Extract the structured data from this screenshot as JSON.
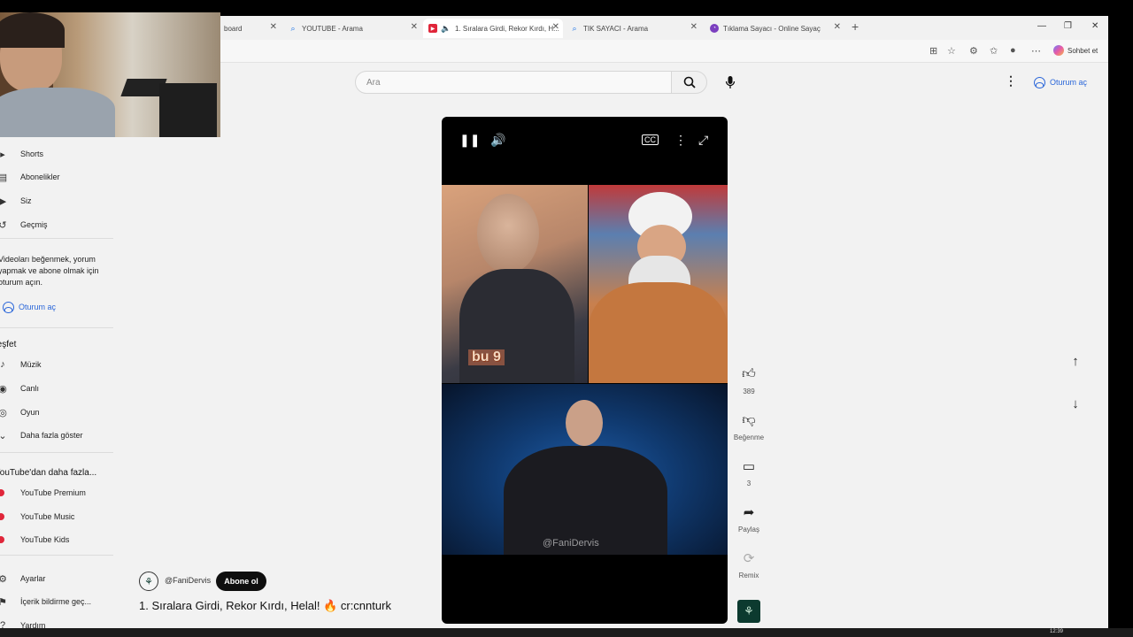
{
  "browser": {
    "tabs": [
      {
        "label": "board",
        "icon": "dashboard-icon",
        "active": false
      },
      {
        "label": "YOUTUBE - Arama",
        "icon": "search-icon",
        "active": false
      },
      {
        "label": "1. Sıralara Girdi, Rekor Kırdı, H...",
        "icon": "youtube-icon",
        "active": true
      },
      {
        "label": "TIK SAYACI - Arama",
        "icon": "search-icon",
        "active": false
      },
      {
        "label": "Tıklama Sayacı - Online Sayaç",
        "icon": "counter-icon",
        "active": false
      }
    ],
    "copilot_label": "Sohbet et"
  },
  "youtube": {
    "search_placeholder": "Ara",
    "signin_label": "Oturum aç",
    "sidebar": {
      "shorts": "Shorts",
      "subscriptions": "Abonelikler",
      "you": "Siz",
      "history": "Geçmiş",
      "signin_prompt": "Videoları beğenmek, yorum yapmak ve abone olmak için oturum açın.",
      "signin_button": "Oturum aç",
      "explore_heading": "Keşfet",
      "explore_items": [
        "Müzik",
        "Canlı",
        "Oyun",
        "Daha fazla göster"
      ],
      "more_heading": "YouTube'dan daha fazla...",
      "more_items": [
        "YouTube Premium",
        "YouTube Music",
        "YouTube Kids"
      ],
      "bottom_items": [
        "Ayarlar",
        "İçerik bildirme geç...",
        "Yardım"
      ]
    },
    "video": {
      "overlay_text": "bu 9",
      "watermark": "@FaniDervis"
    },
    "actions": {
      "like_count": "389",
      "dislike_label": "Beğenme",
      "comment_count": "3",
      "share_label": "Paylaş",
      "remix_label": "Remix"
    },
    "channel": {
      "handle": "@FaniDervis",
      "subscribe_label": "Abone ol"
    },
    "title": "1. Sıralara Girdi, Rekor Kırdı, Helal! 🔥 cr:cnnturk"
  },
  "taskbar": {
    "clock": "12:39"
  },
  "colors": {
    "accent": "#2a66d9",
    "youtube_red": "#e0263a",
    "page_bg": "#f2f2f2"
  }
}
